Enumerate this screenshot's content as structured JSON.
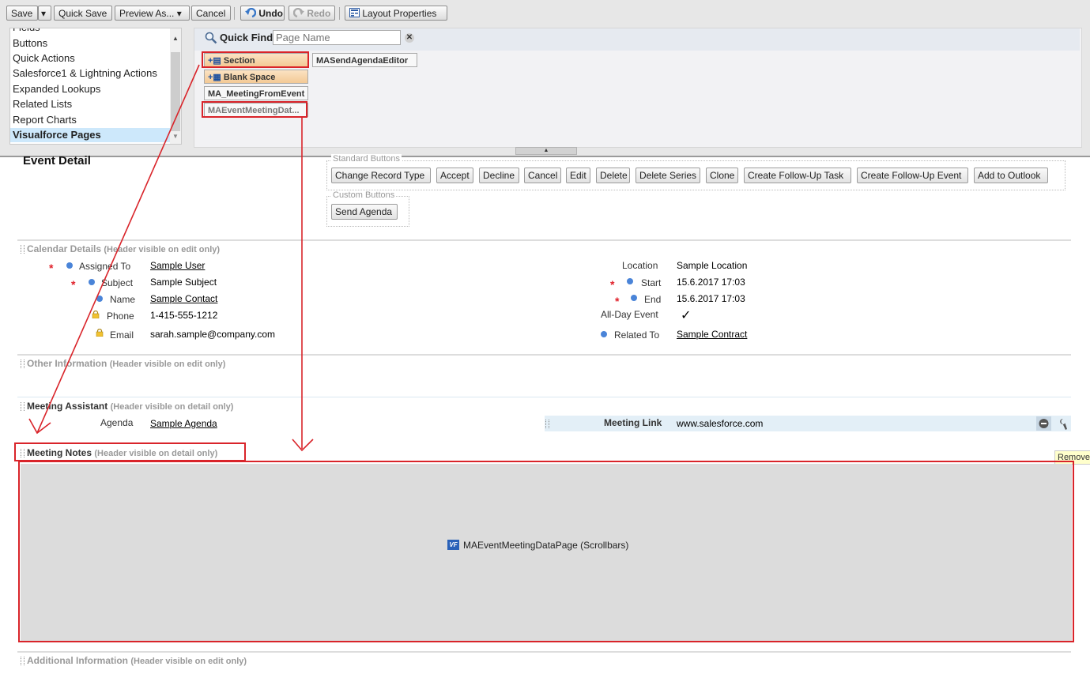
{
  "toolbar": {
    "save": "Save",
    "quick_save": "Quick Save",
    "preview_as": "Preview As...",
    "cancel": "Cancel",
    "undo": "Undo",
    "redo": "Redo",
    "layout_properties": "Layout Properties"
  },
  "palette": {
    "categories": [
      {
        "label": "Fields"
      },
      {
        "label": "Buttons"
      },
      {
        "label": "Quick Actions"
      },
      {
        "label": "Salesforce1 & Lightning Actions"
      },
      {
        "label": "Expanded Lookups"
      },
      {
        "label": "Related Lists"
      },
      {
        "label": "Report Charts"
      },
      {
        "label": "Visualforce Pages",
        "selected": true
      }
    ],
    "quick_find_label": "Quick Find",
    "quick_find_placeholder": "Page Name",
    "items": [
      {
        "label": "Section"
      },
      {
        "label": "MASendAgendaEditor"
      },
      {
        "label": "Blank Space"
      },
      {
        "label": "MA_MeetingFromEvent"
      },
      {
        "label": "MAEventMeetingDat..."
      }
    ]
  },
  "layout": {
    "title": "Event Detail",
    "standard_buttons_label": "Standard Buttons",
    "standard_buttons": [
      "Change Record Type",
      "Accept",
      "Decline",
      "Cancel",
      "Edit",
      "Delete",
      "Delete Series",
      "Clone",
      "Create Follow-Up Task",
      "Create Follow-Up Event",
      "Add to Outlook"
    ],
    "custom_buttons_label": "Custom Buttons",
    "custom_buttons": [
      "Send Agenda"
    ],
    "sections": {
      "calendar": {
        "title": "Calendar Details",
        "note": "(Header visible on edit only)"
      },
      "other": {
        "title": "Other Information",
        "note": "(Header visible on edit only)"
      },
      "assistant": {
        "title": "Meeting Assistant",
        "note": "(Header visible on detail only)"
      },
      "notes": {
        "title": "Meeting Notes",
        "note": "(Header visible on detail only)"
      },
      "additional": {
        "title": "Additional Information",
        "note": "(Header visible on edit only)"
      }
    },
    "calendar_left": [
      {
        "label": "Assigned To",
        "value": "Sample User"
      },
      {
        "label": "Subject",
        "value": "Sample Subject"
      },
      {
        "label": "Name",
        "value": "Sample Contact"
      },
      {
        "label": "Phone",
        "value": "1-415-555-1212"
      },
      {
        "label": "Email",
        "value": "sarah.sample@company.com"
      }
    ],
    "calendar_right": [
      {
        "label": "Location",
        "value": "Sample Location"
      },
      {
        "label": "Start",
        "value": "15.6.2017 17:03"
      },
      {
        "label": "End",
        "value": "15.6.2017 17:03"
      },
      {
        "label": "All-Day Event",
        "value": "✓"
      },
      {
        "label": "Related To",
        "value": "Sample Contract"
      }
    ],
    "assistant_left": {
      "label": "Agenda",
      "value": "Sample Agenda"
    },
    "assistant_right": {
      "label": "Meeting Link",
      "value": "www.salesforce.com"
    },
    "vf_badge": "VF",
    "vf_page": "MAEventMeetingDataPage (Scrollbars)",
    "remove_tooltip": "Remove"
  },
  "colors": {
    "annotation_red": "#d9242a",
    "required_star": "#e0202a",
    "field_dot": "#4a84d8"
  }
}
